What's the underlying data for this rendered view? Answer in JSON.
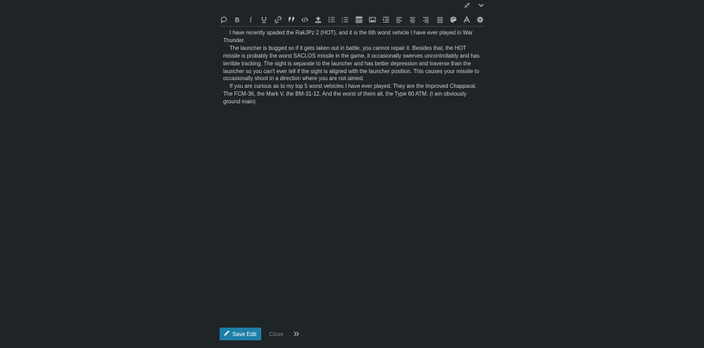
{
  "window_controls": {
    "items": [
      {
        "name": "minimize-icon"
      },
      {
        "name": "chevron-down-icon"
      }
    ]
  },
  "toolbar": {
    "icon_color": "#aeb5b8",
    "items": [
      {
        "name": "speech-bubble-icon"
      },
      {
        "name": "bold-icon"
      },
      {
        "name": "italic-icon"
      },
      {
        "name": "underline-icon"
      },
      {
        "name": "link-icon"
      },
      {
        "name": "quote-icon"
      },
      {
        "name": "code-icon"
      },
      {
        "name": "upload-icon"
      },
      {
        "name": "bullet-list-icon"
      },
      {
        "name": "numbered-list-icon"
      },
      {
        "name": "table-icon"
      },
      {
        "name": "image-icon"
      },
      {
        "name": "indent-icon"
      },
      {
        "name": "align-left-icon"
      },
      {
        "name": "align-center-icon"
      },
      {
        "name": "align-right-icon"
      },
      {
        "name": "align-justify-icon"
      },
      {
        "name": "palette-icon"
      },
      {
        "name": "font-icon"
      },
      {
        "name": "gear-icon"
      }
    ]
  },
  "editor": {
    "paragraphs": [
      "I have recently spaded the RakJPz 2 (HOT), and it is the 6th worst vehicle I have ever played in War Thunder.",
      "The launcher is bugged so if it gets taken out in battle, you cannot repair it. Besides that, the HOT missile is probably the worst SACLOS missile in the game, it occasionally swerves uncontrollably and has terrible tracking. The sight is separate to the launcher and has better depression and traverse than the launcher so you can't ever tell if the sight is aligned with the launcher position. This causes your missile to occasionally shoot in a direction where you are not aimed.",
      "If you are curious as to my top 5 worst vehicles I have ever played. They are the Improved Chapparal, The FCM-36, the Mark V, the BM-31-12, And the worst of them all, the Type 60 ATM. (I am obviously ground main)"
    ]
  },
  "footer": {
    "save_label": "Save Edit",
    "close_label": "Close",
    "accent": "#1f7fa8"
  }
}
